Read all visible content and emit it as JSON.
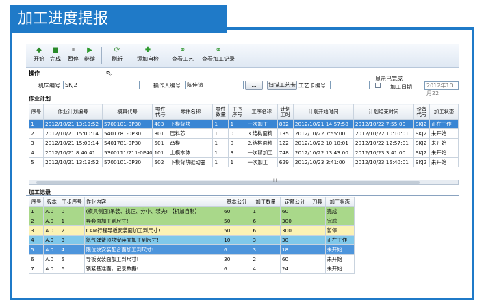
{
  "banner": {
    "title": "加工进度提报"
  },
  "toolbar": {
    "buttons": [
      {
        "label": "开始",
        "icon": "◆"
      },
      {
        "label": "完成",
        "icon": "■"
      },
      {
        "label": "暂停",
        "icon": "⏸"
      },
      {
        "label": "继续",
        "icon": "▶"
      },
      {
        "label": "刷新",
        "icon": "⟳"
      },
      {
        "label": "添加自检",
        "icon": "✚"
      },
      {
        "label": "查看工艺",
        "icon": "⚭"
      },
      {
        "label": "查看加工记录",
        "icon": "⚭"
      }
    ]
  },
  "operation": {
    "section_label": "操作",
    "machine_label": "机床编号",
    "machine_value": "SKJ2",
    "operator_label": "操作人编号",
    "operator_value": "陈佳涛",
    "browse_button": "...",
    "scan_button": "扫描工艺卡",
    "card_label": "工艺卡编号",
    "card_value": "",
    "show_done_label": "显示已完成",
    "date_label": "加工日期",
    "date_value": "2012年10月22"
  },
  "plan": {
    "section_label": "作业计划",
    "columns": [
      "序号",
      "作业计划编号",
      "模具代号",
      "零件代号",
      "零件名称",
      "零件数量",
      "工序序号",
      "工序名称",
      "计划工时",
      "计划开始时间",
      "计划结束时间",
      "设备代号",
      "加工状态"
    ],
    "rows": [
      [
        "1",
        "2012/10/21 13:19:52",
        "5700101-0P30",
        "403",
        "下模背块",
        "1",
        "1",
        "一次加工",
        "882",
        "2012/10/21 14:57:58",
        "2012/10/22 7:55:00",
        "SKJ2",
        "正在工作"
      ],
      [
        "2",
        "2012/10/21 15:00:14",
        "5401781-0P30",
        "301",
        "压料芯",
        "1",
        "0",
        "3.结构面精",
        "135",
        "2012/10/22 7:55:00",
        "2012/10/22 10:10:01",
        "SKJ2",
        "未开始"
      ],
      [
        "3",
        "2012/10/21 15:00:14",
        "5401781-0P30",
        "501",
        "凸模",
        "1",
        "0",
        "2.结构面精",
        "122",
        "2012/10/22 10:10:01",
        "2012/10/22 12:57:01",
        "SKJ2",
        "未开始"
      ],
      [
        "4",
        "2012/10/21 8:40:41",
        "5300111/211-0P40",
        "101",
        "上模本体",
        "1",
        "3",
        "一次精加工",
        "748",
        "2012/10/22 13:43:00",
        "2012/10/23 3:41:00",
        "SKJ2",
        "未开始"
      ],
      [
        "5",
        "2012/10/21 13:19:52",
        "5700101-0P30",
        "502",
        "下模背块驱动器",
        "1",
        "1",
        "一次加工",
        "629",
        "2012/10/23 3:41:00",
        "2012/10/23 15:40:01",
        "SKJ2",
        "未开始"
      ]
    ],
    "scroll_marker": "III"
  },
  "records": {
    "section_label": "加工记录",
    "columns": [
      "序号",
      "版本",
      "工步序号",
      "作业内容",
      "基本公分",
      "加工数量",
      "定额公分",
      "刀具",
      "加工状态"
    ],
    "rows": [
      [
        "1",
        "A.0",
        "0",
        "(模具侧面)吊装、找正、分中、装夹! 【机加自制】",
        "60",
        "1",
        "60",
        "",
        "完成"
      ],
      [
        "2",
        "A.0",
        "1",
        "导套面加工到尺寸!",
        "50",
        "6",
        "300",
        "",
        "完成"
      ],
      [
        "3",
        "A.0",
        "2",
        "CAM行程导板安装面加工到尺寸!",
        "50",
        "6",
        "300",
        "",
        "暂停"
      ],
      [
        "4",
        "A.0",
        "3",
        "氮气弹簧顶块安装面加工到尺寸!",
        "10",
        "3",
        "30",
        "",
        "正在工作"
      ],
      [
        "5",
        "A.0",
        "4",
        "限位块安装配合面加工到尺寸!",
        "6",
        "3",
        "18",
        "",
        "未开始"
      ],
      [
        "6",
        "A.0",
        "5",
        "导板安装面加工到尺寸!",
        "30",
        "2",
        "60",
        "",
        "未开始"
      ],
      [
        "7",
        "A.0",
        "6",
        "锁紧基准面，记录数据!",
        "6",
        "4",
        "24",
        "",
        "未开始"
      ]
    ]
  }
}
